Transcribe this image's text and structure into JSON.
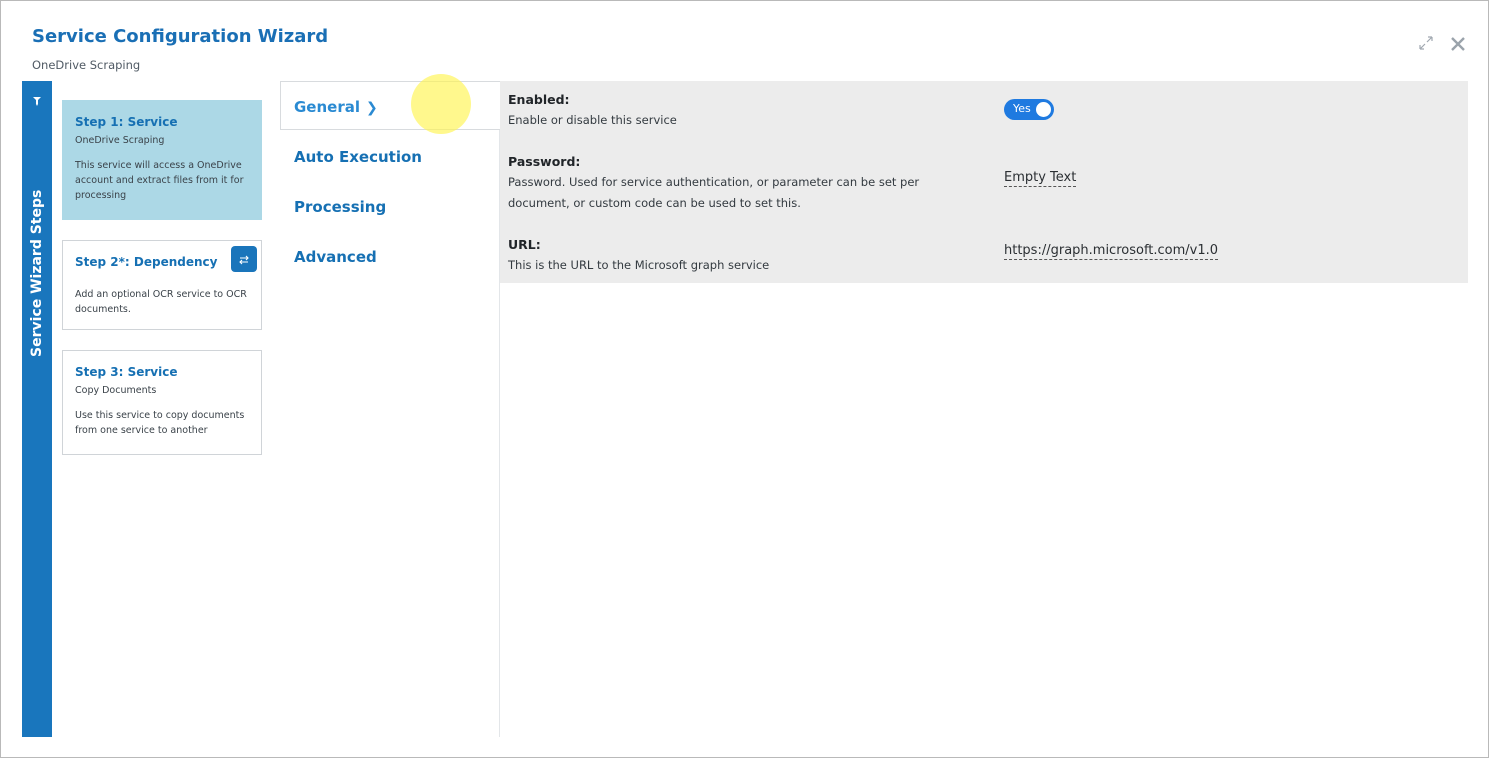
{
  "window": {
    "title": "Service Configuration Wizard",
    "subtitle": "OneDrive Scraping"
  },
  "icons": {
    "expand": "expand-icon",
    "close": "close-icon",
    "pin": "pin-icon",
    "swap": "swap-icon"
  },
  "sidebar": {
    "label": "Service Wizard Steps"
  },
  "steps": [
    {
      "title": "Step 1: Service",
      "subtitle": "OneDrive Scraping",
      "description": "This service will access a OneDrive account and extract files from it for processing",
      "active": true
    },
    {
      "title": "Step 2*: Dependency",
      "subtitle": "",
      "description": "Add an optional OCR service to OCR documents.",
      "active": false
    },
    {
      "title": "Step 3: Service",
      "subtitle": "Copy Documents",
      "description": "Use this service to copy documents from one service to another",
      "active": false
    }
  ],
  "tabs": [
    {
      "label": "General",
      "active": true
    },
    {
      "label": "Auto Execution",
      "active": false
    },
    {
      "label": "Processing",
      "active": false
    },
    {
      "label": "Advanced",
      "active": false
    }
  ],
  "fields": {
    "enabled": {
      "label": "Enabled:",
      "description": "Enable or disable this service",
      "value": "Yes"
    },
    "password": {
      "label": "Password:",
      "description": "Password. Used for service authentication, or parameter can be set per document, or custom code can be used to set this.",
      "value": "Empty Text"
    },
    "url": {
      "label": "URL:",
      "description": "This is the URL to the Microsoft graph service",
      "value": "https://graph.microsoft.com/v1.0"
    }
  },
  "colors": {
    "accent": "#1976bd",
    "active_step": "#acd8e6",
    "toggle_on": "#1f7ae0",
    "panel": "#ececec"
  }
}
